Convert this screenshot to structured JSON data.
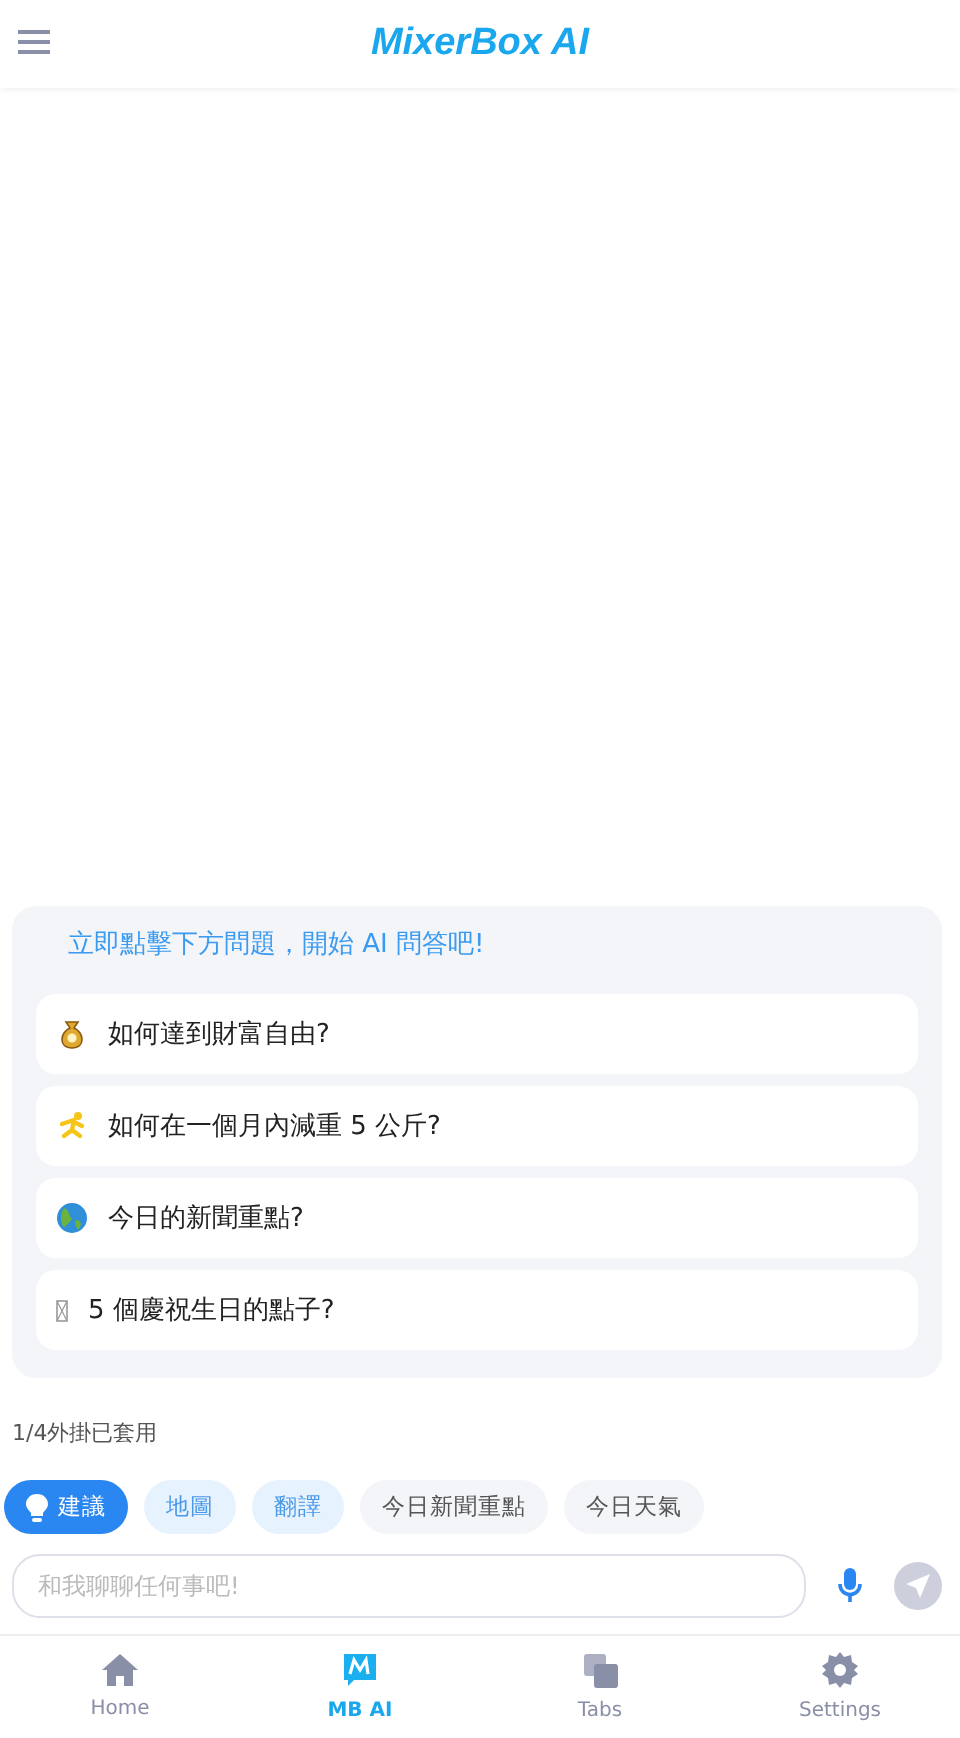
{
  "header": {
    "title": "MixerBox AI"
  },
  "prompt_card": {
    "heading": "立即點擊下方問題，開始 AI 問答吧!",
    "questions": [
      {
        "text": "如何達到財富自由?"
      },
      {
        "text": "如何在一個月內減重 5 公斤?"
      },
      {
        "text": "今日的新聞重點?"
      },
      {
        "text": "5 個慶祝生日的點子?"
      }
    ]
  },
  "plugin_status": "1/4外掛已套用",
  "chips": [
    {
      "kind": "suggest",
      "label": "建議",
      "selected": true
    },
    {
      "kind": "plugin",
      "label": "地圖",
      "selected": false
    },
    {
      "kind": "plugin",
      "label": "翻譯",
      "selected": false
    },
    {
      "kind": "topic",
      "label": "今日新聞重點",
      "selected": false
    },
    {
      "kind": "topic",
      "label": "今日天氣",
      "selected": false
    }
  ],
  "input": {
    "placeholder": "和我聊聊任何事吧!"
  },
  "nav": [
    {
      "label": "Home",
      "selected": false
    },
    {
      "label": "MB AI",
      "selected": true
    },
    {
      "label": "Tabs",
      "selected": false
    },
    {
      "label": "Settings",
      "selected": false
    }
  ]
}
